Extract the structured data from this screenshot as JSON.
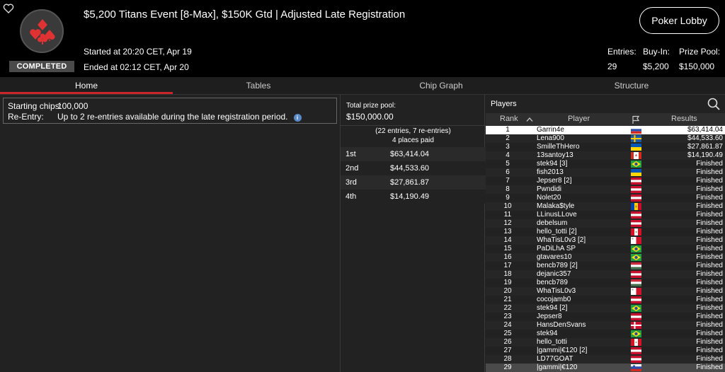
{
  "header": {
    "title": "$5,200 Titans Event [8-Max], $150K Gtd | Adjusted Late Registration",
    "status": "COMPLETED",
    "started": "Started at 20:20 CET, Apr 19",
    "ended": "Ended at 02:12 CET, Apr 20",
    "lobby_button": "Poker Lobby",
    "stats": {
      "entries_label": "Entries:",
      "entries_value": "29",
      "buyin_label": "Buy-In:",
      "buyin_value": "$5,200",
      "prizepool_label": "Prize Pool:",
      "prizepool_value": "$150,000"
    }
  },
  "tabs": [
    {
      "label": "Home",
      "active": true
    },
    {
      "label": "Tables",
      "active": false
    },
    {
      "label": "Chip Graph",
      "active": false
    },
    {
      "label": "Structure",
      "active": false
    }
  ],
  "home_info": {
    "starting_chips_label": "Starting chips:",
    "starting_chips_value": "100,000",
    "reentry_label": "Re-Entry:",
    "reentry_value": "Up to 2 re-entries available during the late registration period."
  },
  "prize": {
    "title": "Total prize pool:",
    "amount": "$150,000.00",
    "entries_note": "(22 entries, 7 re-entries)",
    "places_note": "4 places paid",
    "payouts": [
      {
        "place": "1st",
        "amount": "$63,414.04"
      },
      {
        "place": "2nd",
        "amount": "$44,533.60"
      },
      {
        "place": "3rd",
        "amount": "$27,861.87"
      },
      {
        "place": "4th",
        "amount": "$14,190.49"
      }
    ]
  },
  "players": {
    "title": "Players",
    "headers": {
      "rank": "Rank",
      "player": "Player",
      "results": "Results"
    },
    "rows": [
      {
        "rank": "1",
        "name": "Garrin4e",
        "flag": "ru",
        "result": "$63,414.04"
      },
      {
        "rank": "2",
        "name": "Lena900",
        "flag": "se",
        "result": "$44,533.60"
      },
      {
        "rank": "3",
        "name": "SmilleThHero",
        "flag": "ua",
        "result": "$27,861.87"
      },
      {
        "rank": "4",
        "name": "13santoy13",
        "flag": "ca",
        "result": "$14,190.49"
      },
      {
        "rank": "5",
        "name": "stek94 [3]",
        "flag": "br",
        "result": "Finished"
      },
      {
        "rank": "6",
        "name": "fish2013",
        "flag": "ua",
        "result": "Finished"
      },
      {
        "rank": "7",
        "name": "Jepser8 [2]",
        "flag": "at",
        "result": "Finished"
      },
      {
        "rank": "8",
        "name": "Pwndidi",
        "flag": "at",
        "result": "Finished"
      },
      {
        "rank": "9",
        "name": "Nolet20",
        "flag": "at",
        "result": "Finished"
      },
      {
        "rank": "10",
        "name": "Malaka$tyle",
        "flag": "md",
        "result": "Finished"
      },
      {
        "rank": "11",
        "name": "LLinusLLove",
        "flag": "at",
        "result": "Finished"
      },
      {
        "rank": "12",
        "name": "debelsum",
        "flag": "at",
        "result": "Finished"
      },
      {
        "rank": "13",
        "name": "hello_totti [2]",
        "flag": "pe",
        "result": "Finished"
      },
      {
        "rank": "14",
        "name": "WhaTisL0v3 [2]",
        "flag": "mt",
        "result": "Finished"
      },
      {
        "rank": "15",
        "name": "PaDiLhA SP",
        "flag": "br",
        "result": "Finished"
      },
      {
        "rank": "16",
        "name": "gtavares10",
        "flag": "br",
        "result": "Finished"
      },
      {
        "rank": "17",
        "name": "bencb789 [2]",
        "flag": "hu",
        "result": "Finished"
      },
      {
        "rank": "18",
        "name": "dejanic357",
        "flag": "at",
        "result": "Finished"
      },
      {
        "rank": "19",
        "name": "bencb789",
        "flag": "hu",
        "result": "Finished"
      },
      {
        "rank": "20",
        "name": "WhaTisL0v3",
        "flag": "mt",
        "result": "Finished"
      },
      {
        "rank": "21",
        "name": "cocojamb0",
        "flag": "at",
        "result": "Finished"
      },
      {
        "rank": "22",
        "name": "stek94 [2]",
        "flag": "br",
        "result": "Finished"
      },
      {
        "rank": "23",
        "name": "Jepser8",
        "flag": "at",
        "result": "Finished"
      },
      {
        "rank": "24",
        "name": "HansDenSvans",
        "flag": "dk",
        "result": "Finished"
      },
      {
        "rank": "25",
        "name": "stek94",
        "flag": "br",
        "result": "Finished"
      },
      {
        "rank": "26",
        "name": "hello_totti",
        "flag": "pe",
        "result": "Finished"
      },
      {
        "rank": "27",
        "name": "|gammi|€120 [2]",
        "flag": "at",
        "result": "Finished"
      },
      {
        "rank": "28",
        "name": "LD77GOAT",
        "flag": "at",
        "result": "Finished"
      },
      {
        "rank": "29",
        "name": "|gammi|€120",
        "flag": "si",
        "result": "Finished"
      }
    ]
  },
  "colors": {
    "accent": "#c8262b",
    "bg": "#222222"
  }
}
